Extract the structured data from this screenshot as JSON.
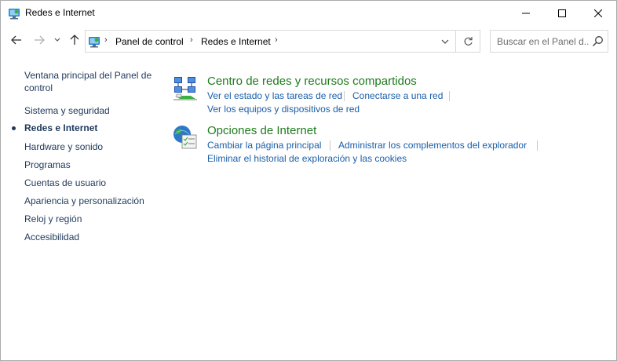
{
  "window": {
    "title": "Redes e Internet",
    "title_icon": "control-panel-icon"
  },
  "address": {
    "items": [
      "Panel de control",
      "Redes e Internet"
    ],
    "separator": "›"
  },
  "search": {
    "placeholder": "Buscar en el Panel d..."
  },
  "sidebar": {
    "items": [
      {
        "label": "Ventana principal del Panel de control",
        "current": false
      },
      {
        "label": "Sistema y seguridad",
        "current": false
      },
      {
        "label": "Redes e Internet",
        "current": true
      },
      {
        "label": "Hardware y sonido",
        "current": false
      },
      {
        "label": "Programas",
        "current": false
      },
      {
        "label": "Cuentas de usuario",
        "current": false
      },
      {
        "label": "Apariencia y personalización",
        "current": false
      },
      {
        "label": "Reloj y región",
        "current": false
      },
      {
        "label": "Accesibilidad",
        "current": false
      }
    ]
  },
  "categories": [
    {
      "title": "Centro de redes y recursos compartidos",
      "icon": "network-sharing-center-icon",
      "tasks": [
        "Ver el estado y las tareas de red",
        "Conectarse a una red",
        "Ver los equipos y dispositivos de red"
      ]
    },
    {
      "title": "Opciones de Internet",
      "icon": "internet-options-icon",
      "tasks": [
        "Cambiar la página principal",
        "Administrar los complementos del explorador",
        "Eliminar el historial de exploración y las cookies"
      ]
    }
  ],
  "colors": {
    "category_title": "#1e7b1e",
    "task_link": "#1a5ea8",
    "sidebar_link": "#1e395b"
  }
}
